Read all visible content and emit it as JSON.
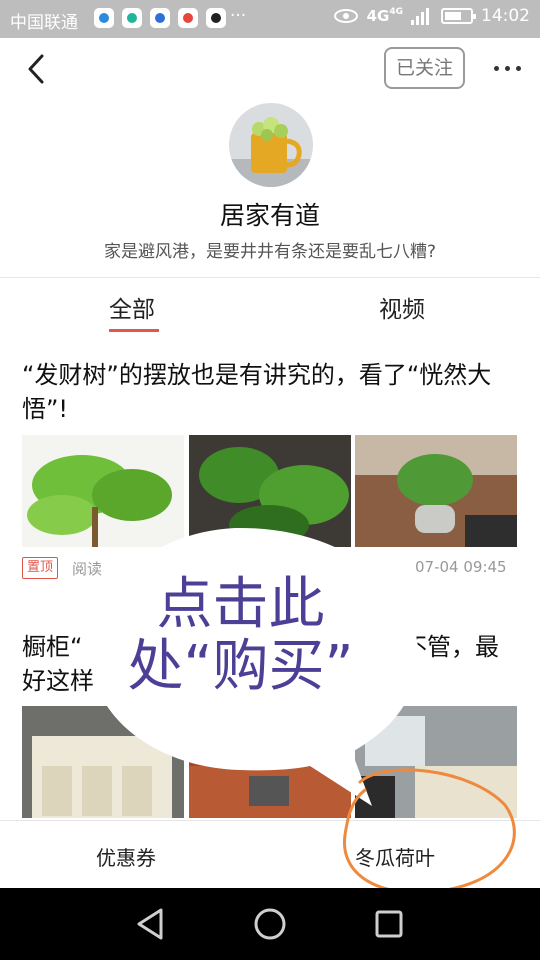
{
  "status_bar": {
    "carrier": "中国联通",
    "more": "···",
    "network": "4G",
    "network_small": "4G",
    "time": "14:02"
  },
  "header": {
    "follow_label": "已关注",
    "more_icon": "more-dots-icon",
    "back_icon": "back-arrow-icon"
  },
  "profile": {
    "name": "居家有道",
    "description": "家是避风港，是要井井有条还是要乱七八糟?"
  },
  "tabs": [
    {
      "label": "全部",
      "active": true
    },
    {
      "label": "视频",
      "active": false
    }
  ],
  "articles": [
    {
      "title": "“发财树”的摆放也是有讲究的，看了“恍然大悟”!",
      "badge": "置顶",
      "reads": "阅读",
      "time": "07-04 09:45"
    },
    {
      "title_left": "橱柜“",
      "title_right": "不管，最",
      "title_line2": "好这样"
    }
  ],
  "overlay": {
    "callout_line1": "点击此",
    "callout_line2": "处“购买”",
    "circle_color": "#ee8a3e",
    "text_color": "#4b3f96"
  },
  "bottom_bar": {
    "item_left": "优惠券",
    "item_right": "冬瓜荷叶"
  },
  "colors": {
    "accent": "#e2574c",
    "status_bar": "#bdbdbd"
  }
}
